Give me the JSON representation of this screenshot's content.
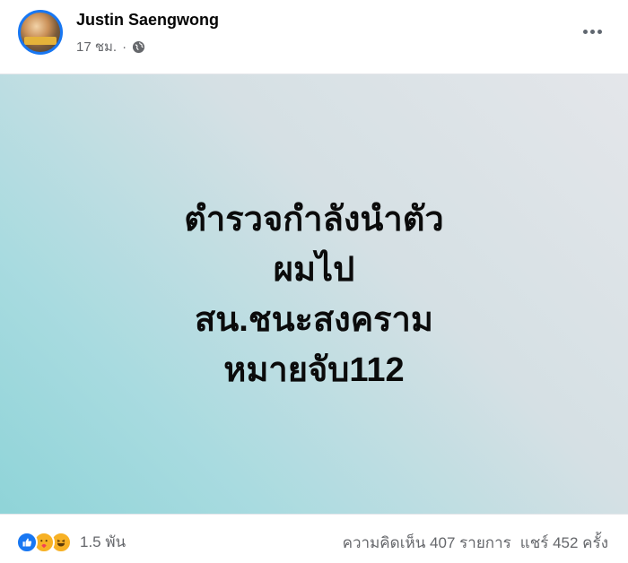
{
  "post": {
    "author": "Justin Saengwong",
    "time": "17 ชม.",
    "separator": "·",
    "privacy_icon": "globe-icon",
    "more_icon": "more-horizontal-icon",
    "media_text_lines": [
      "ตำรวจกำลังนำตัว",
      "ผมไป",
      "สน.ชนะสงคราม",
      "หมายจับ112"
    ],
    "reactions": {
      "icons": [
        "like-icon",
        "care-icon",
        "haha-icon"
      ],
      "count": "1.5 พัน"
    },
    "comments": "ความคิดเห็น 407 รายการ",
    "shares": "แชร์ 452 ครั้ง"
  },
  "colors": {
    "accent": "#1877f2",
    "secondary_text": "#65676b",
    "primary_text": "#050505"
  }
}
